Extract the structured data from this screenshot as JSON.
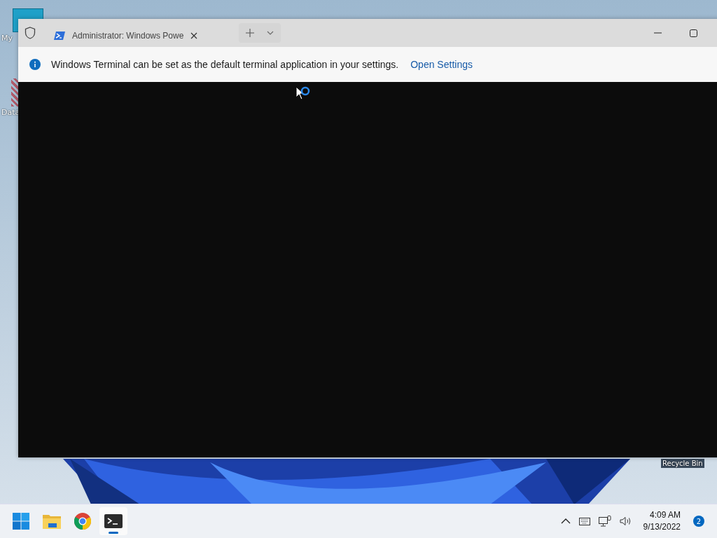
{
  "desktop": {
    "icons": [
      {
        "label": "My"
      },
      {
        "label": "Data"
      },
      {
        "label": "Recycle Bin"
      }
    ]
  },
  "window": {
    "tabs": [
      {
        "title": "Administrator: Windows Powe",
        "selected": true
      }
    ],
    "infobar": {
      "message": "Windows Terminal can be set as the default terminal application in your settings.",
      "link": "Open Settings"
    }
  },
  "taskbar": {
    "apps": [
      {
        "kind": "start",
        "active": false
      },
      {
        "kind": "folder",
        "active": false
      },
      {
        "kind": "browser",
        "active": false
      },
      {
        "kind": "terminal",
        "active": true
      }
    ],
    "time": "4:09 AM",
    "date": "9/13/2022",
    "notifications": "2"
  }
}
